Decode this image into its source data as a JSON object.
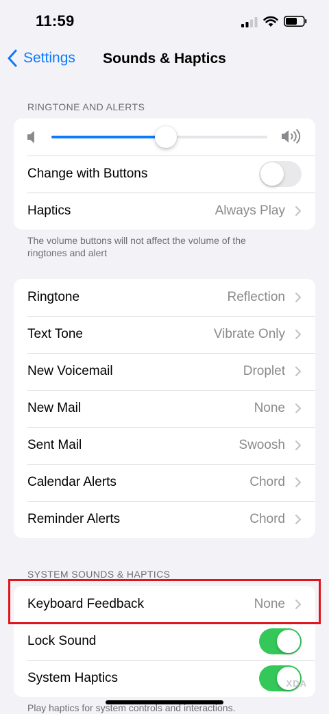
{
  "status_bar": {
    "time": "11:59"
  },
  "nav": {
    "back_label": "Settings",
    "title": "Sounds & Haptics"
  },
  "ringtone_section": {
    "header": "RINGTONE AND ALERTS",
    "volume_level": 0.53,
    "change_with_buttons": {
      "label": "Change with Buttons",
      "on": false
    },
    "haptics": {
      "label": "Haptics",
      "value": "Always Play"
    },
    "footer": "The volume buttons will not affect the volume of the ringtones and alert"
  },
  "tones": [
    {
      "label": "Ringtone",
      "value": "Reflection"
    },
    {
      "label": "Text Tone",
      "value": "Vibrate Only"
    },
    {
      "label": "New Voicemail",
      "value": "Droplet"
    },
    {
      "label": "New Mail",
      "value": "None"
    },
    {
      "label": "Sent Mail",
      "value": "Swoosh"
    },
    {
      "label": "Calendar Alerts",
      "value": "Chord"
    },
    {
      "label": "Reminder Alerts",
      "value": "Chord"
    }
  ],
  "system_section": {
    "header": "SYSTEM SOUNDS & HAPTICS",
    "keyboard_feedback": {
      "label": "Keyboard Feedback",
      "value": "None"
    },
    "lock_sound": {
      "label": "Lock Sound",
      "on": true
    },
    "system_haptics": {
      "label": "System Haptics",
      "on": true
    },
    "footer": "Play haptics for system controls and interactions."
  },
  "watermark": "XDA",
  "colors": {
    "accent": "#0a7aff",
    "toggle_on": "#34c759",
    "highlight": "#e0151c"
  }
}
